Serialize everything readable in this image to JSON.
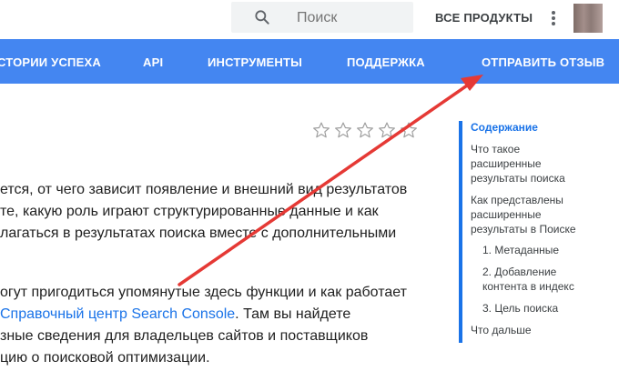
{
  "header": {
    "search_placeholder": "Поиск",
    "all_products": "ВСЕ ПРОДУКТЫ"
  },
  "nav": {
    "items": [
      "СТОРИИ УСПЕХА",
      "API",
      "ИНСТРУМЕНТЫ",
      "ПОДДЕРЖКА",
      "ОТПРАВИТЬ ОТЗЫВ"
    ]
  },
  "rating": {
    "stars": 5,
    "filled": 0
  },
  "content": {
    "lines": [
      "ется, от чего зависит появление и внешний вид результатов",
      "те, какую роль играют структурированные данные и как",
      "лагаться в результатах поиска вместе с дополнительными",
      "огут пригодиться упомянутые здесь функции и как работает"
    ],
    "link_text": "Справочный центр Search Console",
    "after_link": ". Там вы найдете",
    "line7": "зные сведения для владельцев сайтов и поставщиков",
    "line8": "цию о поисковой оптимизации."
  },
  "toc": {
    "title": "Содержание",
    "items": [
      "Что такое",
      "расширенные",
      "результаты поиска",
      "Как представлены",
      "расширенные",
      "результаты в Поиске",
      "1. Метаданные",
      "2. Добавление",
      "контента в индекс",
      "3. Цель поиска",
      "Что дальше"
    ]
  },
  "colors": {
    "nav_background": "#4486f1",
    "link": "#1a73e8",
    "annotation_arrow": "#e53935"
  }
}
